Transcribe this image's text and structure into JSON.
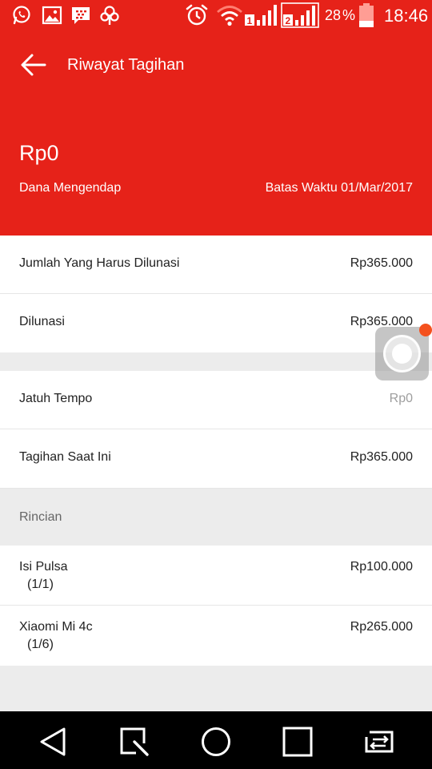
{
  "status_bar": {
    "battery_percent": "28",
    "percent_sign": "%",
    "time": "18:46",
    "sim1": "1",
    "sim2": "2"
  },
  "header": {
    "title": "Riwayat Tagihan",
    "amount": "Rp0",
    "balance_label": "Dana Mengendap",
    "deadline": "Batas Waktu 01/Mar/2017"
  },
  "summary": [
    {
      "label": "Jumlah Yang Harus Dilunasi",
      "value": "Rp365.000"
    },
    {
      "label": "Dilunasi",
      "value": "Rp365.000"
    }
  ],
  "billing": [
    {
      "label": "Jatuh Tempo",
      "value": "Rp0"
    },
    {
      "label": "Tagihan Saat Ini",
      "value": "Rp365.000"
    }
  ],
  "details_section": {
    "title": "Rincian",
    "items": [
      {
        "name": "Isi Pulsa",
        "installment": "(1/1)",
        "value": "Rp100.000"
      },
      {
        "name": "Xiaomi Mi 4c",
        "installment": "(1/6)",
        "value": "Rp265.000"
      }
    ]
  },
  "colors": {
    "primary": "#e62219",
    "float_badge": "#f4511e"
  },
  "icons": {
    "status_bar": [
      "whatsapp-icon",
      "gallery-icon",
      "bbm-icon",
      "tree-icon",
      "alarm-icon",
      "wifi-icon",
      "signal-icon",
      "battery-icon"
    ],
    "navigation": [
      "back-icon",
      "search-icon",
      "home-icon",
      "recents-icon",
      "switch-icon"
    ],
    "app_bar": "arrow-back-icon",
    "floating": "assistive-touch-icon"
  }
}
